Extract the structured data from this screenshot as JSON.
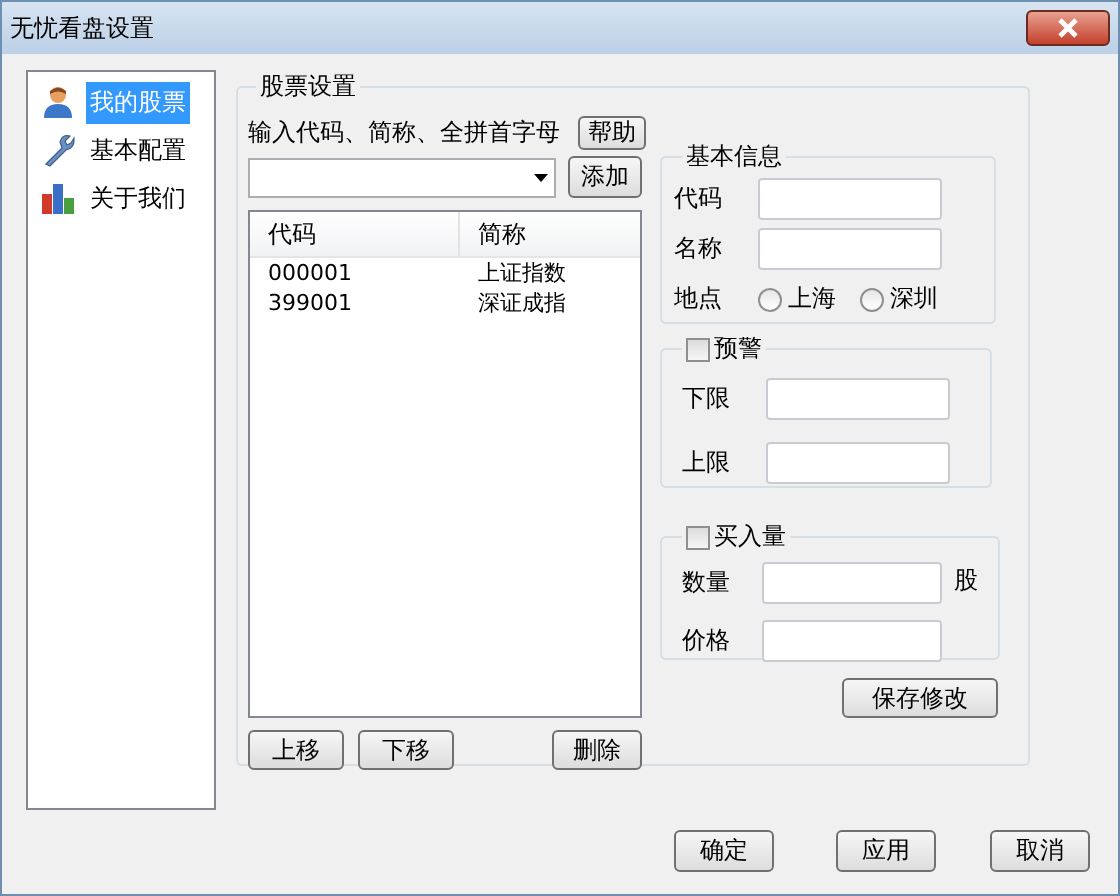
{
  "window": {
    "title": "无忧看盘设置"
  },
  "sidebar": {
    "items": [
      {
        "label": "我的股票",
        "selected": true
      },
      {
        "label": "基本配置",
        "selected": false
      },
      {
        "label": "关于我们",
        "selected": false
      }
    ]
  },
  "stock_settings": {
    "title": "股票设置",
    "hint": "输入代码、简称、全拼首字母",
    "help_button": "帮助",
    "add_button": "添加",
    "list": {
      "columns": [
        "代码",
        "简称"
      ],
      "rows": [
        [
          "000001",
          "上证指数"
        ],
        [
          "399001",
          "深证成指"
        ]
      ]
    },
    "buttons": [
      "上移",
      "下移",
      "删除"
    ]
  },
  "basic_info": {
    "title": "基本信息",
    "fields": [
      {
        "label": "代码"
      },
      {
        "label": "名称"
      }
    ],
    "location": {
      "label": "地点",
      "options": [
        {
          "label": "上海",
          "selected": false
        },
        {
          "label": "深圳",
          "selected": false
        }
      ]
    }
  },
  "alert": {
    "label": "预警",
    "checked": false,
    "fields": [
      {
        "label": "下限"
      },
      {
        "label": "上限"
      }
    ]
  },
  "buy": {
    "label": "买入量",
    "checked": false,
    "fields": [
      {
        "label": "数量",
        "unit": "股"
      },
      {
        "label": "价格"
      }
    ]
  },
  "save_button": "保存修改",
  "footer_buttons": [
    "确定",
    "应用",
    "取消"
  ]
}
